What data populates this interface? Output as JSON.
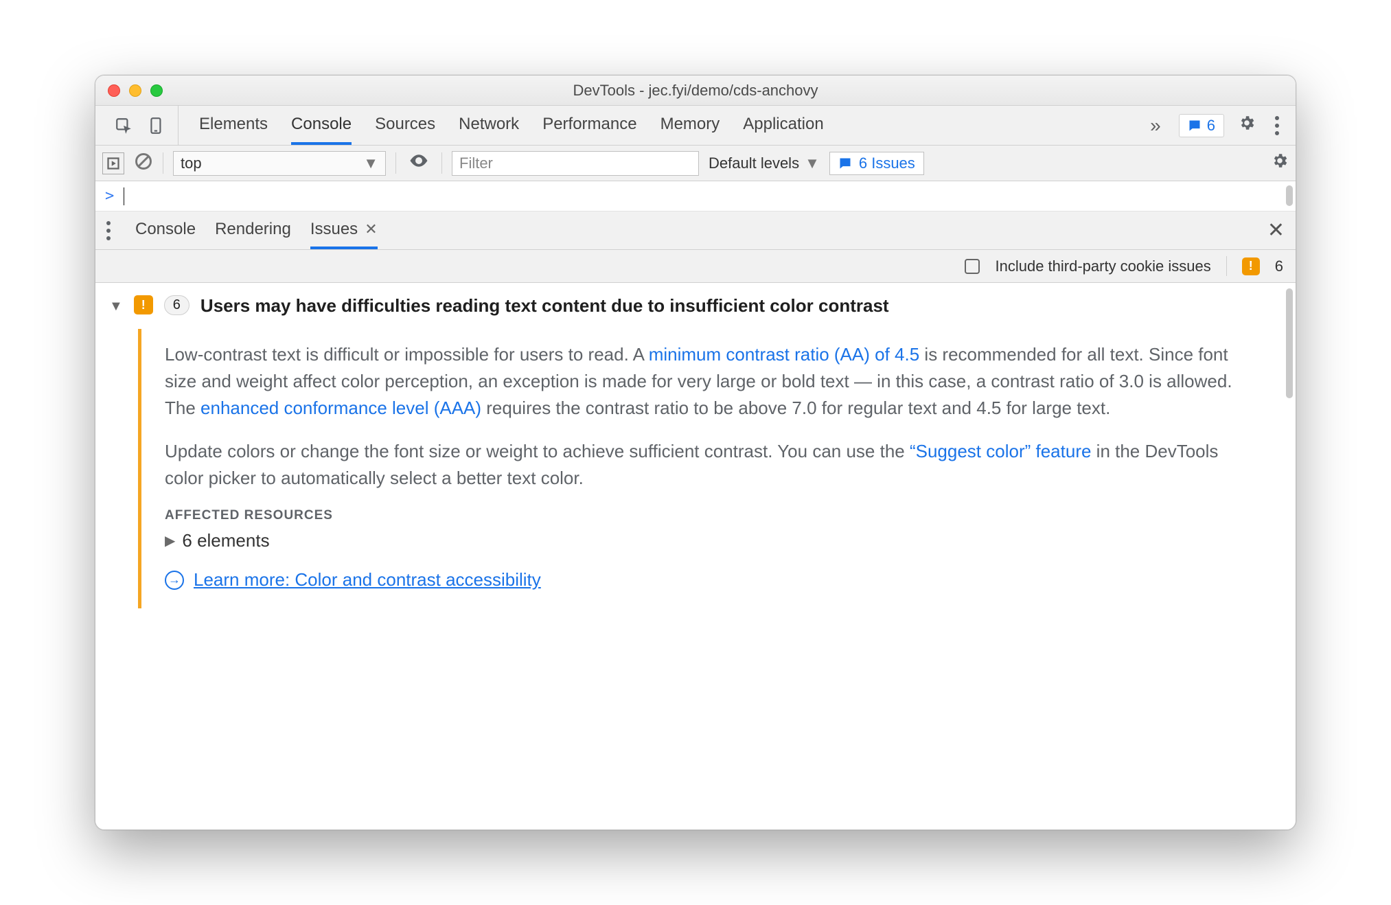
{
  "window": {
    "title": "DevTools - jec.fyi/demo/cds-anchovy"
  },
  "mainTabs": {
    "items": [
      "Elements",
      "Console",
      "Sources",
      "Network",
      "Performance",
      "Memory",
      "Application"
    ],
    "activeIndex": 1,
    "overflowGlyph": "»",
    "issuesChip": {
      "count": "6"
    }
  },
  "consoleBar": {
    "context": "top",
    "filterPlaceholder": "Filter",
    "levels": "Default levels",
    "issuesLabel": "6 Issues"
  },
  "prompt": {
    "glyph": ">"
  },
  "drawer": {
    "tabs": [
      {
        "label": "Console"
      },
      {
        "label": "Rendering"
      },
      {
        "label": "Issues",
        "active": true,
        "closeGlyph": "✕"
      }
    ]
  },
  "issuesOptions": {
    "thirdPartyLabel": "Include third-party cookie issues",
    "count": "6",
    "badge": "!"
  },
  "issue": {
    "countPill": "6",
    "badge": "!",
    "title": "Users may have difficulties reading text content due to insufficient color contrast",
    "p1a": "Low-contrast text is difficult or impossible for users to read. A ",
    "p1link1": "minimum contrast ratio (AA) of 4.5",
    "p1b": " is recommended for all text. Since font size and weight affect color perception, an exception is made for very large or bold text — in this case, a contrast ratio of 3.0 is allowed. The ",
    "p1link2": "enhanced conformance level (AAA)",
    "p1c": " requires the contrast ratio to be above 7.0 for regular text and 4.5 for large text.",
    "p2a": "Update colors or change the font size or weight to achieve sufficient contrast. You can use the ",
    "p2link": "“Suggest color” feature",
    "p2b": " in the DevTools color picker to automatically select a better text color.",
    "affectedHeading": "AFFECTED RESOURCES",
    "affectedExpander": "6 elements",
    "learnMore": "Learn more: Color and contrast accessibility"
  }
}
